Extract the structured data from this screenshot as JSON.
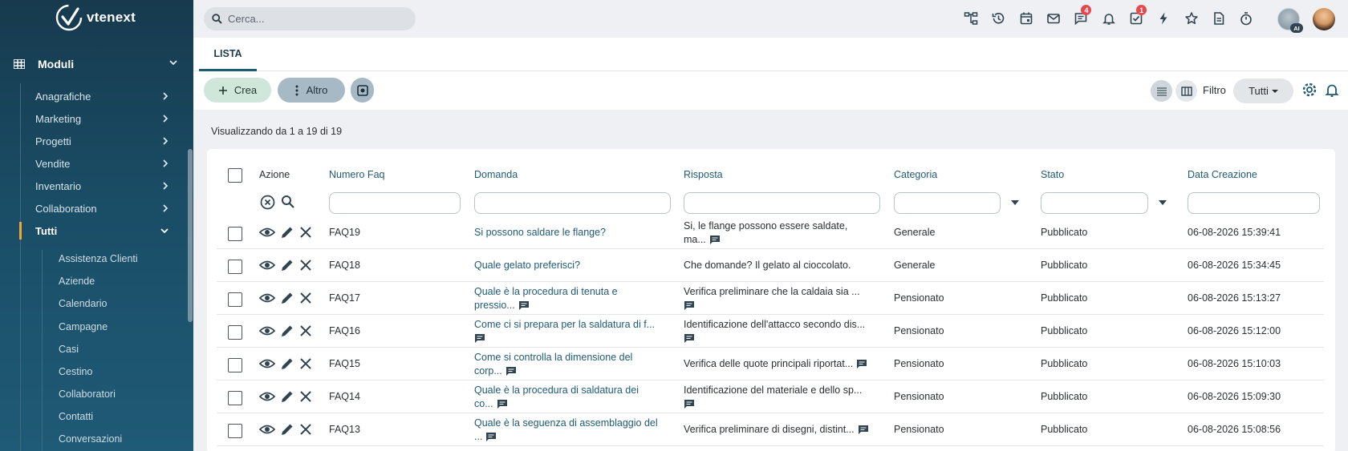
{
  "app": {
    "logo_text": "vtenext"
  },
  "sidebar": {
    "modules_label": "Moduli",
    "items": [
      {
        "label": "Anagrafiche"
      },
      {
        "label": "Marketing"
      },
      {
        "label": "Progetti"
      },
      {
        "label": "Vendite"
      },
      {
        "label": "Inventario"
      },
      {
        "label": "Collaboration"
      },
      {
        "label": "Tutti"
      }
    ],
    "sub_items": [
      {
        "label": "Assistenza Clienti"
      },
      {
        "label": "Aziende"
      },
      {
        "label": "Calendario"
      },
      {
        "label": "Campagne"
      },
      {
        "label": "Casi"
      },
      {
        "label": "Cestino"
      },
      {
        "label": "Collaboratori"
      },
      {
        "label": "Contatti"
      },
      {
        "label": "Conversazioni"
      }
    ]
  },
  "topbar": {
    "search_placeholder": "Cerca...",
    "messages_badge": "4",
    "todo_badge": "1",
    "ai_badge": "AI"
  },
  "tabs": [
    {
      "label": "LISTA"
    }
  ],
  "toolbar": {
    "create_label": "Crea",
    "more_label": "Altro",
    "filter_label": "Filtro",
    "filter_value": "Tutti"
  },
  "list": {
    "count_text": "Visualizzando da 1 a 19 di 19",
    "columns": {
      "action": "Azione",
      "number": "Numero Faq",
      "question": "Domanda",
      "answer": "Risposta",
      "category": "Categoria",
      "status": "Stato",
      "created": "Data Creazione"
    },
    "rows": [
      {
        "number": "FAQ19",
        "question": "Si possono saldare le flange?",
        "answer_1": "Si, le flange possono essere saldate,",
        "answer_2": "ma...",
        "category": "Generale",
        "status": "Pubblicato",
        "created": "06-08-2026 15:39:41"
      },
      {
        "number": "FAQ18",
        "question": "Quale gelato preferisci?",
        "answer_1": "Che domande? Il gelato al cioccolato.",
        "category": "Generale",
        "status": "Pubblicato",
        "created": "06-08-2026 15:34:45"
      },
      {
        "number": "FAQ17",
        "question_1": "Quale è la procedura di tenuta e",
        "question_2": "pressio...",
        "answer_1": "Verifica preliminare che la caldaia sia ...",
        "category": "Pensionato",
        "status": "Pubblicato",
        "created": "06-08-2026 15:13:27"
      },
      {
        "number": "FAQ16",
        "question_1": "Come ci si prepara per la saldatura di f...",
        "answer_1": "Identificazione dell'attacco secondo dis...",
        "category": "Pensionato",
        "status": "Pubblicato",
        "created": "06-08-2026 15:12:00"
      },
      {
        "number": "FAQ15",
        "question_1": "Come si controlla la dimensione del",
        "question_2": "corp...",
        "answer_1": "Verifica delle quote principali riportat...",
        "category": "Pensionato",
        "status": "Pubblicato",
        "created": "06-08-2026 15:10:03"
      },
      {
        "number": "FAQ14",
        "question_1": "Quale è la procedura di saldatura dei",
        "question_2": "co...",
        "answer_1": "Identificazione del materiale e dello sp...",
        "category": "Pensionato",
        "status": "Pubblicato",
        "created": "06-08-2026 15:09:30"
      },
      {
        "number": "FAQ13",
        "question_1": "Quale è la seguenza di assemblaggio del",
        "question_2": "...",
        "answer_1": "Verifica preliminare di disegni, distint...",
        "category": "Pensionato",
        "status": "Pubblicato",
        "created": "06-08-2026 15:08:56"
      }
    ]
  },
  "colors": {
    "sidebar": "#1a4d66",
    "accent": "#1f5a76",
    "active_marker": "#f2a531",
    "badge": "#e5484d",
    "create_btn": "#cfe6da"
  }
}
